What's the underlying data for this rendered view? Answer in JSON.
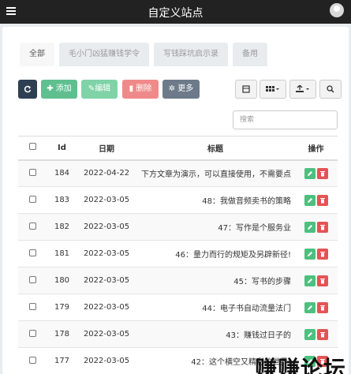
{
  "app": {
    "title": "自定义站点"
  },
  "tabs": [
    {
      "label": "全部",
      "active": true
    },
    {
      "label": "毛小门凶猛赚钱学令",
      "active": false
    },
    {
      "label": "写钱踩坑启示录",
      "active": false
    },
    {
      "label": "备用",
      "active": false
    }
  ],
  "toolbar": {
    "refresh_icon": "refresh-icon",
    "add_label": "添加",
    "edit_label": "编辑",
    "delete_label": "删除",
    "more_label": "更多"
  },
  "search": {
    "placeholder": "搜索"
  },
  "table": {
    "headers": {
      "id": "Id",
      "date": "日期",
      "title": "标题",
      "actions": "操作"
    },
    "rows": [
      {
        "id": "184",
        "date": "2022-04-22",
        "title": "下方文章为演示，可以直接使用，不需要点"
      },
      {
        "id": "183",
        "date": "2022-03-05",
        "title": "48：我做音频卖书的策略"
      },
      {
        "id": "182",
        "date": "2022-03-05",
        "title": "47：写作是个服务业"
      },
      {
        "id": "181",
        "date": "2022-03-05",
        "title": "46：量力而行的规矩及另辟新径!"
      },
      {
        "id": "180",
        "date": "2022-03-05",
        "title": "45：写书的步骤"
      },
      {
        "id": "179",
        "date": "2022-03-05",
        "title": "44：电子书自动流量法门"
      },
      {
        "id": "178",
        "date": "2022-03-05",
        "title": "43：赚钱过日子的"
      },
      {
        "id": "177",
        "date": "2022-03-05",
        "title": "42：这个横空又精彩的世界!"
      }
    ]
  },
  "watermark": "赚赚论坛"
}
